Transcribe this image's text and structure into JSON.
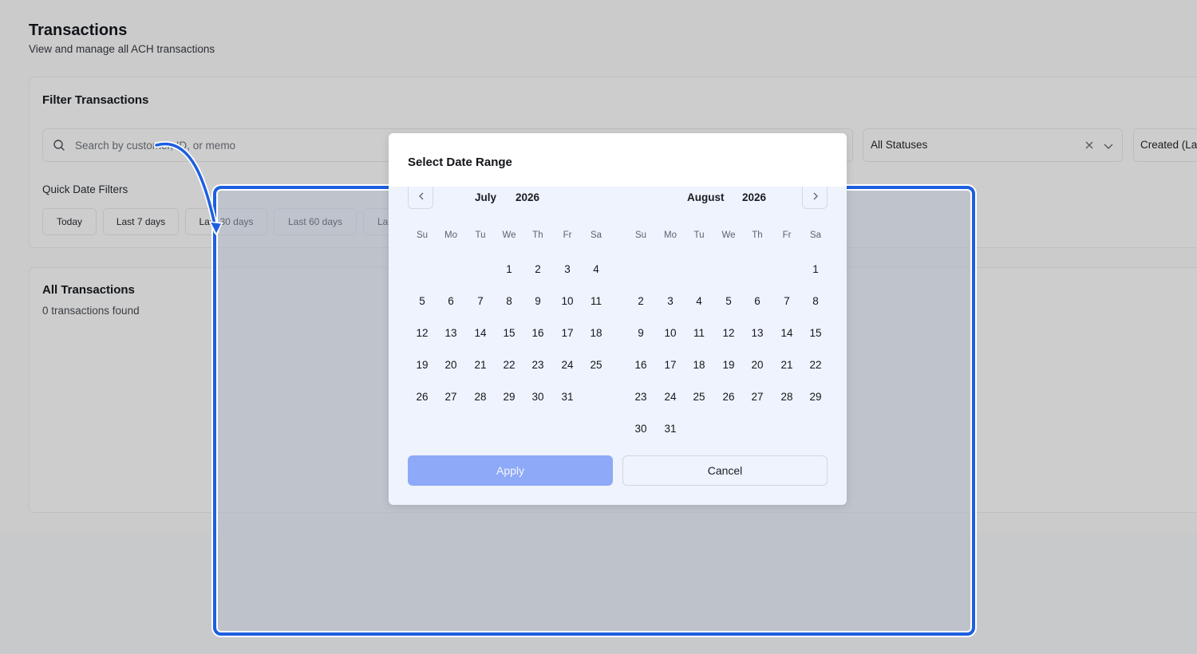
{
  "page": {
    "title": "Transactions",
    "subtitle": "View and manage all ACH transactions"
  },
  "filter": {
    "title": "Filter Transactions",
    "search_placeholder": "Search by customer, ID, or memo",
    "status_value": "All Statuses",
    "created_value": "Created (La",
    "quick_label": "Quick Date Filters",
    "chips": [
      "Today",
      "Last 7 days",
      "Last 30 days",
      "Last 60 days",
      "La"
    ]
  },
  "transactions": {
    "title": "All Transactions",
    "count_text": "0 transactions found"
  },
  "date_modal": {
    "title": "Select Date Range",
    "weekdays": [
      "Su",
      "Mo",
      "Tu",
      "We",
      "Th",
      "Fr",
      "Sa"
    ],
    "months": [
      {
        "month": "July",
        "year": "2026",
        "first_weekday": 3,
        "days": 31
      },
      {
        "month": "August",
        "year": "2026",
        "first_weekday": 6,
        "days": 31
      }
    ],
    "apply_label": "Apply",
    "cancel_label": "Cancel"
  },
  "colors": {
    "highlight_border": "#1d5fe0",
    "apply_bg": "#8ea9f7",
    "modal_bg": "#eef3fd"
  }
}
